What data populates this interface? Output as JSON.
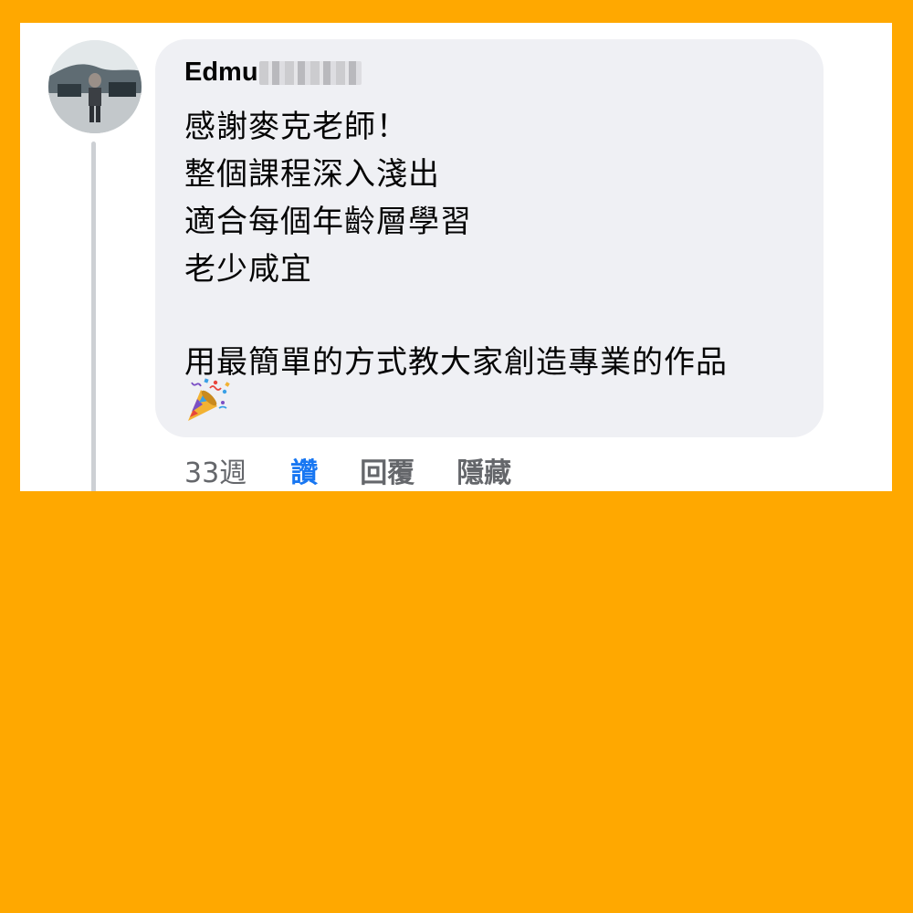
{
  "comment": {
    "author_visible": "Edmu",
    "lines": [
      "感謝麥克老師！",
      "整個課程深入淺出",
      "適合每個年齡層學習",
      "老少咸宜",
      "用最簡單的方式教大家創造專業的作品"
    ],
    "emoji": "party-popper",
    "timestamp": "33週",
    "actions": {
      "like": "讚",
      "reply": "回覆",
      "hide": "隱藏"
    }
  },
  "colors": {
    "background": "#FFA800",
    "card": "#FFFFFF",
    "bubble": "#EFF0F4",
    "like_active": "#1877F2",
    "secondary_text": "#65676B",
    "thread_line": "#CDD0D4"
  }
}
